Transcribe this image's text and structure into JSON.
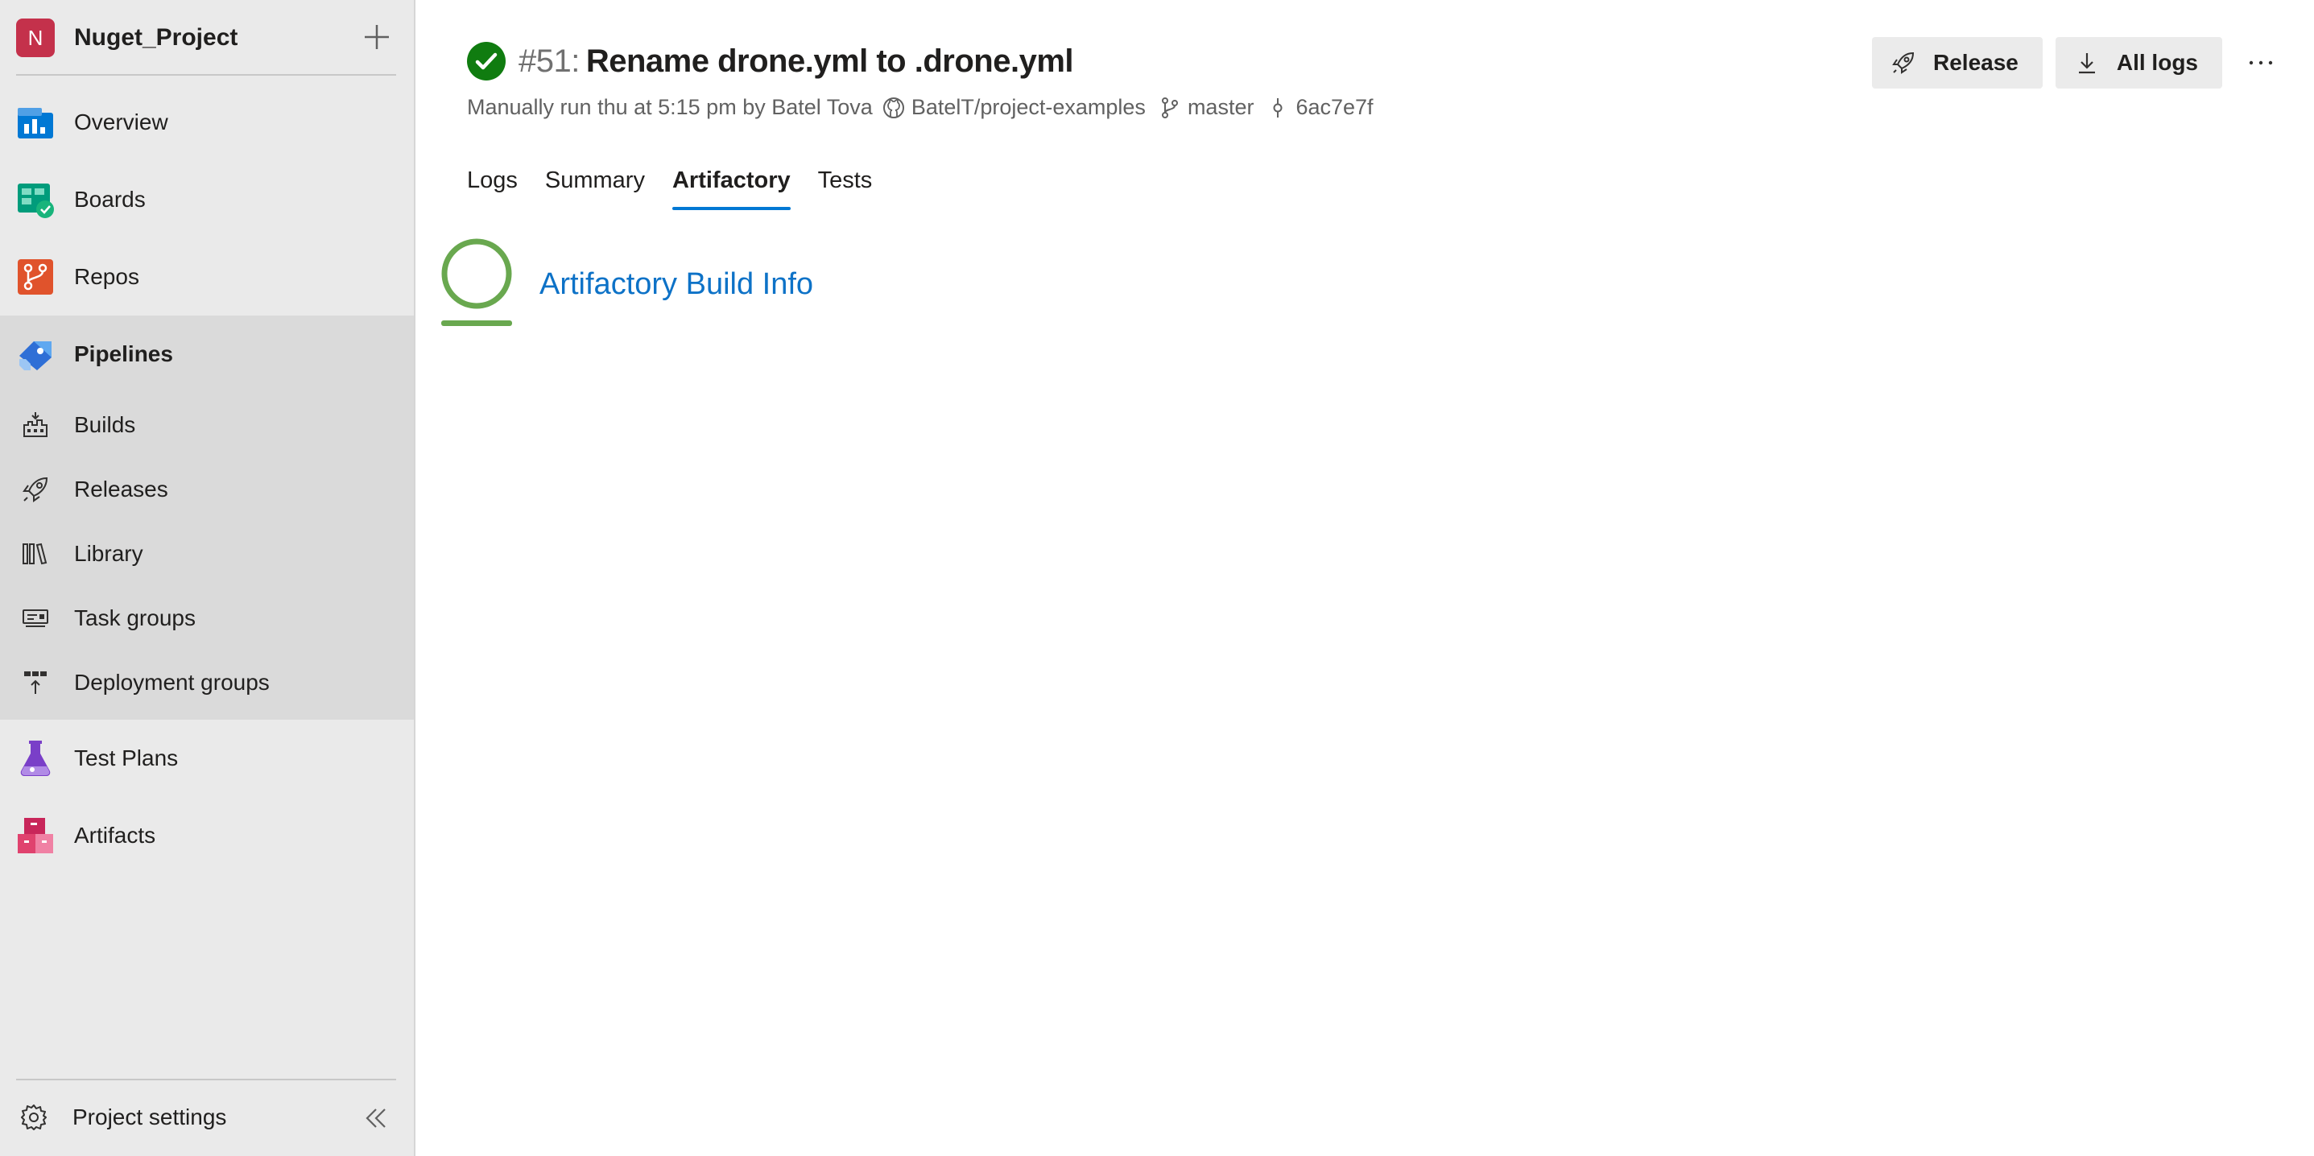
{
  "sidebar": {
    "project": {
      "initial": "N",
      "name": "Nuget_Project"
    },
    "items": [
      {
        "label": "Overview",
        "icon": "overview-icon"
      },
      {
        "label": "Boards",
        "icon": "boards-icon"
      },
      {
        "label": "Repos",
        "icon": "repos-icon"
      },
      {
        "label": "Pipelines",
        "icon": "pipelines-icon"
      }
    ],
    "pipelines_sub": [
      {
        "label": "Builds",
        "icon": "builds-icon"
      },
      {
        "label": "Releases",
        "icon": "releases-icon"
      },
      {
        "label": "Library",
        "icon": "library-icon"
      },
      {
        "label": "Task groups",
        "icon": "task-groups-icon"
      },
      {
        "label": "Deployment groups",
        "icon": "deployment-groups-icon"
      }
    ],
    "items_after": [
      {
        "label": "Test Plans",
        "icon": "test-plans-icon"
      },
      {
        "label": "Artifacts",
        "icon": "artifacts-icon"
      }
    ],
    "footer": {
      "label": "Project settings"
    }
  },
  "run": {
    "number": "#51:",
    "title": "Rename drone.yml to .drone.yml",
    "trigger": "Manually run thu at 5:15 pm by Batel Tova",
    "repo": "BatelT/project-examples",
    "branch": "master",
    "commit": "6ac7e7f"
  },
  "tabs": [
    "Logs",
    "Summary",
    "Artifactory",
    "Tests"
  ],
  "active_tab": "Artifactory",
  "actions": {
    "release_label": "Release",
    "all_logs_label": "All logs"
  },
  "content": {
    "artifact_link": "Artifactory Build Info"
  },
  "colors": {
    "accent": "#0078d4",
    "success": "#107c10",
    "link": "#0d72c7",
    "avatar": "#c4314b"
  }
}
